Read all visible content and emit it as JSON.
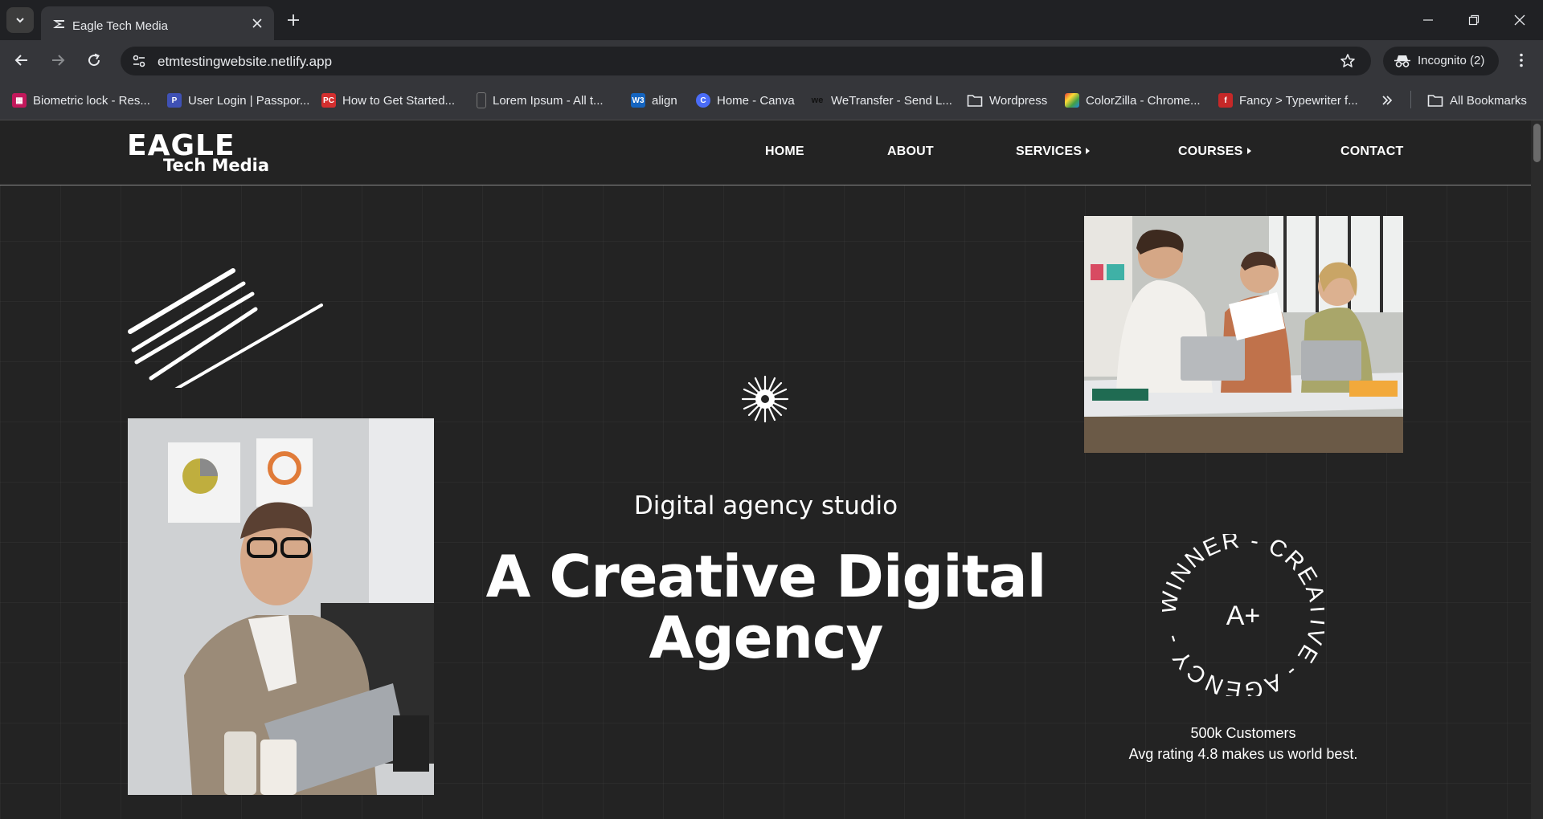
{
  "browser": {
    "tab_title": "Eagle Tech Media",
    "url": "etmtestingwebsite.netlify.app",
    "incognito_label": "Incognito (2)",
    "bookmarks": [
      {
        "label": "Biometric lock - Res...",
        "icon": "biometric-favicon",
        "color": "#c2185b"
      },
      {
        "label": "User Login | Passpor...",
        "icon": "passport-favicon",
        "color": "#3f51b5"
      },
      {
        "label": "How to Get Started...",
        "icon": "pc-favicon",
        "color": "#d32f2f"
      },
      {
        "label": "Lorem Ipsum - All t...",
        "icon": "lorem-favicon",
        "color": "#555555"
      },
      {
        "label": "align",
        "icon": "w3schools-favicon",
        "color": "#1565c0"
      },
      {
        "label": "Home - Canva",
        "icon": "canva-favicon",
        "color": "#4a6cf7"
      },
      {
        "label": "WeTransfer - Send L...",
        "icon": "wetransfer-favicon",
        "color": "#222222"
      },
      {
        "label": "Wordpress",
        "icon": "folder-icon",
        "color": "#e8eaed"
      },
      {
        "label": "ColorZilla - Chrome...",
        "icon": "colorzilla-favicon",
        "color": "#e65100"
      },
      {
        "label": "Fancy > Typewriter f...",
        "icon": "fancy-favicon",
        "color": "#c62828"
      }
    ],
    "all_bookmarks_label": "All Bookmarks"
  },
  "site": {
    "logo_top": "EAGLE",
    "logo_bottom": "Tech Media",
    "nav": {
      "home": "HOME",
      "about": "ABOUT",
      "services": "SERVICES",
      "courses": "COURSES",
      "contact": "CONTACT"
    },
    "hero": {
      "subtitle": "Digital agency studio",
      "headline_line1": "A Creative Digital",
      "headline_line2": "Agency"
    },
    "badge": {
      "ring_text": "WINNER - CREATIVE - AGENCY - ",
      "grade": "A+"
    },
    "customers_line1": "500k Customers",
    "customers_line2": "Avg rating 4.8 makes us world best."
  }
}
